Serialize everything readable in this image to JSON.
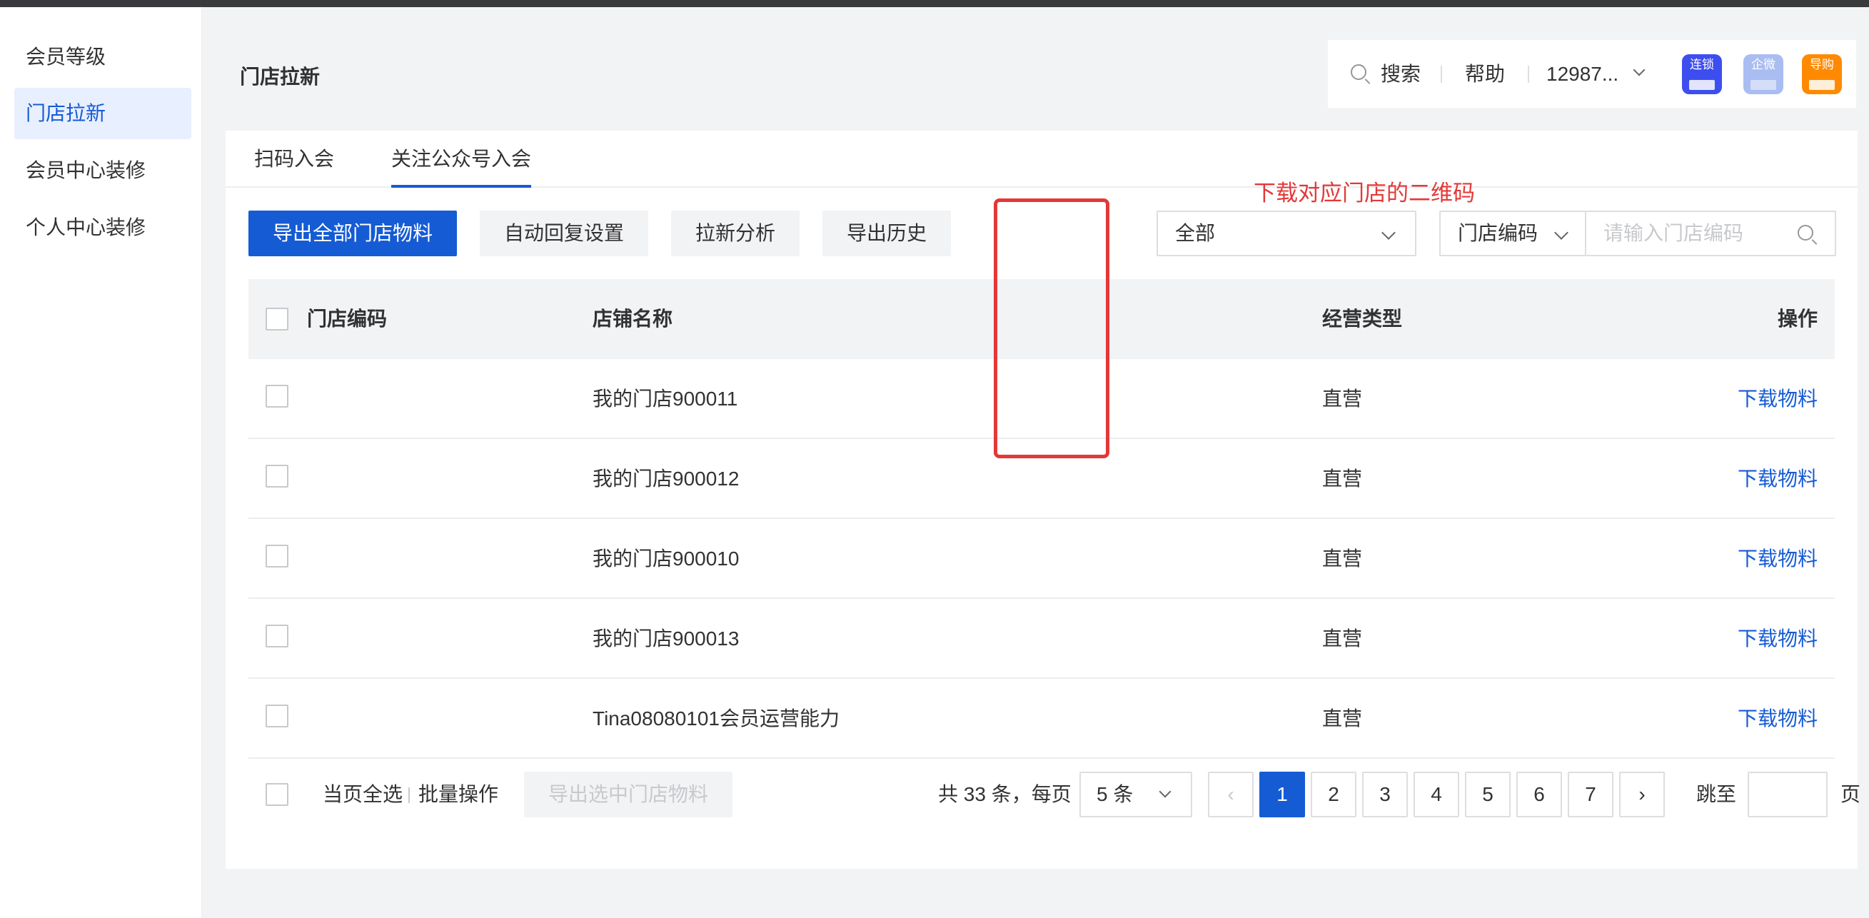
{
  "sidebar": {
    "items": [
      {
        "label": "会员等级"
      },
      {
        "label": "门店拉新"
      },
      {
        "label": "会员中心装修"
      },
      {
        "label": "个人中心装修"
      }
    ],
    "active_index": 1
  },
  "page": {
    "title": "门店拉新"
  },
  "header": {
    "search_label": "搜索",
    "help_label": "帮助",
    "account": "12987...",
    "apps": [
      {
        "label": "连锁",
        "color": "#3d4ef0"
      },
      {
        "label": "企微",
        "color": "#a9bdf2"
      },
      {
        "label": "导购",
        "color": "#ff8a00"
      }
    ]
  },
  "tabs": [
    {
      "label": "扫码入会"
    },
    {
      "label": "关注公众号入会"
    }
  ],
  "active_tab": 1,
  "annotation": "下载对应门店的二维码",
  "toolbar": {
    "export_all": "导出全部门店物料",
    "auto_reply": "自动回复设置",
    "analysis": "拉新分析",
    "export_history": "导出历史",
    "type_select": "全部",
    "field_select": "门店编码",
    "search_placeholder": "请输入门店编码"
  },
  "table": {
    "columns": [
      "门店编码",
      "店铺名称",
      "经营类型",
      "操作"
    ],
    "rows": [
      {
        "code": "",
        "name": "我的门店900011",
        "type": "直营",
        "action": "下载物料"
      },
      {
        "code": "",
        "name": "我的门店900012",
        "type": "直营",
        "action": "下载物料"
      },
      {
        "code": "",
        "name": "我的门店900010",
        "type": "直营",
        "action": "下载物料"
      },
      {
        "code": "",
        "name": "我的门店900013",
        "type": "直营",
        "action": "下载物料"
      },
      {
        "code": "",
        "name": "Tina08080101会员运营能力",
        "type": "直营",
        "action": "下载物料"
      }
    ]
  },
  "footer": {
    "select_page": "当页全选",
    "batch": "批量操作",
    "export_selected": "导出选中门店物料",
    "total": "共 33 条，每页",
    "page_size": "5 条",
    "pages": [
      "1",
      "2",
      "3",
      "4",
      "5",
      "6",
      "7"
    ],
    "current_page": "1",
    "jump_label": "跳至",
    "page_suffix": "页"
  },
  "colors": {
    "primary": "#155bd4",
    "annotation": "#e33838"
  }
}
